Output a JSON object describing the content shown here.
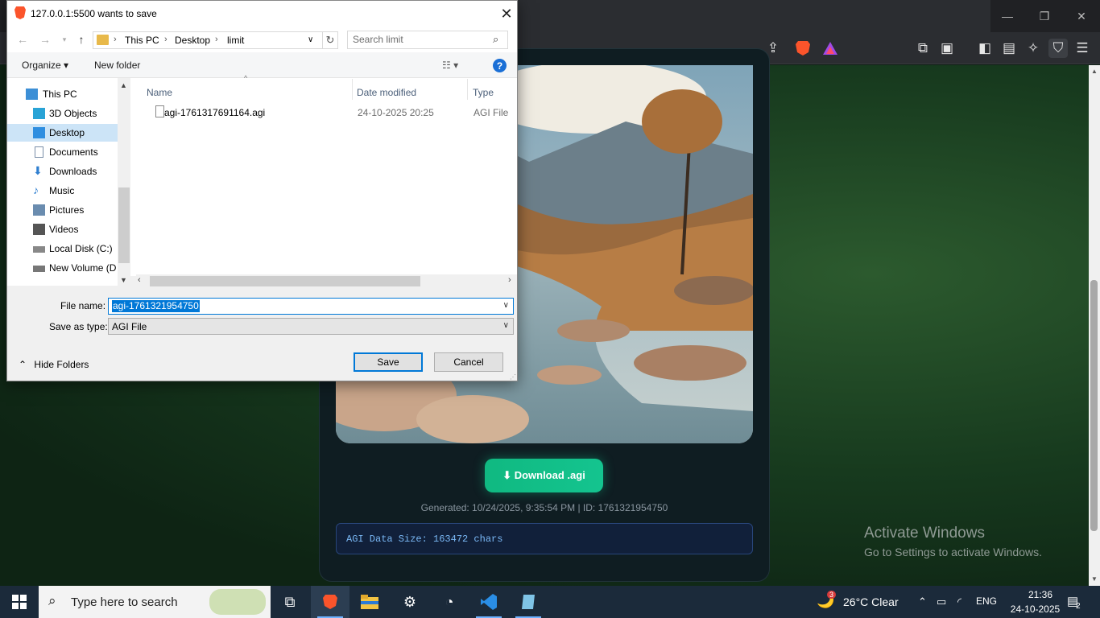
{
  "browser": {
    "window_controls": {
      "minimize": "—",
      "restore": "❐",
      "close": "✕"
    },
    "toolbar_icons": [
      "share-icon",
      "brave-shields-icon",
      "brave-rewards-icon",
      "extensions-icon",
      "reader-mode-icon",
      "sidebar-icon",
      "wallet-icon",
      "leo-ai-icon",
      "vpn-icon",
      "menu-icon"
    ]
  },
  "page": {
    "download_button": "⬇ Download .agi",
    "generated_text": "Generated: 10/24/2025, 9:35:54 PM | ID: 1761321954750",
    "data_size_text": "AGI Data Size: 163472 chars"
  },
  "watermark": {
    "line1": "Activate Windows",
    "line2": "Go to Settings to activate Windows."
  },
  "dialog": {
    "title": "127.0.0.1:5500 wants to save",
    "breadcrumb": [
      "This PC",
      "Desktop",
      "limit"
    ],
    "search_placeholder": "Search limit",
    "organize_label": "Organize ▾",
    "new_folder_label": "New folder",
    "help_label": "?",
    "nav_items": [
      {
        "label": "This PC",
        "icon": "computer-icon",
        "color": "#3c8fd6"
      },
      {
        "label": "3D Objects",
        "icon": "cube-icon",
        "color": "#29a3d6"
      },
      {
        "label": "Desktop",
        "icon": "desktop-icon",
        "color": "#2f8ee0"
      },
      {
        "label": "Documents",
        "icon": "document-icon",
        "color": "#7a8ea8"
      },
      {
        "label": "Downloads",
        "icon": "download-arrow-icon",
        "color": "#2f7fd0"
      },
      {
        "label": "Music",
        "icon": "music-note-icon",
        "color": "#2f7fd0"
      },
      {
        "label": "Pictures",
        "icon": "pictures-icon",
        "color": "#6a8caf"
      },
      {
        "label": "Videos",
        "icon": "film-icon",
        "color": "#555"
      },
      {
        "label": "Local Disk (C:)",
        "icon": "drive-icon",
        "color": "#888"
      },
      {
        "label": "New Volume (D:",
        "icon": "drive-icon",
        "color": "#777"
      }
    ],
    "columns": {
      "name": "Name",
      "date": "Date modified",
      "type": "Type"
    },
    "files": [
      {
        "name": "agi-1761317691164.agi",
        "date": "24-10-2025 20:25",
        "type": "AGI File"
      }
    ],
    "file_name_label": "File name:",
    "file_name_value": "agi-1761321954750",
    "save_type_label": "Save as type:",
    "save_type_value": "AGI File",
    "hide_folders_label": "Hide Folders",
    "save_button": "Save",
    "cancel_button": "Cancel"
  },
  "taskbar": {
    "search_placeholder": "Type here to search",
    "weather_badge": "3",
    "weather_text": "26°C  Clear",
    "language": "ENG",
    "time": "21:36",
    "date": "24-10-2025",
    "notification_count": "2"
  }
}
